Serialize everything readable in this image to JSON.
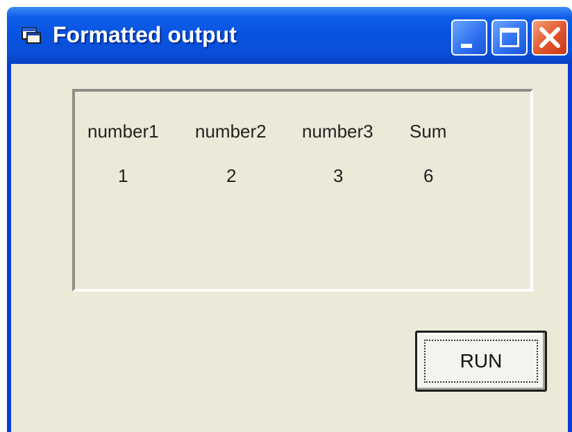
{
  "window": {
    "title": "Formatted output",
    "icon": "form-window-icon",
    "controls": [
      "minimize-icon",
      "maximize-icon",
      "close-icon"
    ]
  },
  "output": {
    "headers": [
      "number1",
      "number2",
      "number3",
      "Sum"
    ],
    "values": [
      "1",
      "2",
      "3",
      "6"
    ]
  },
  "buttons": {
    "run_label": "RUN"
  },
  "colors": {
    "titlebar": "#0a4fd8",
    "client_background": "#ece9d8",
    "close_button": "#e2542a"
  }
}
